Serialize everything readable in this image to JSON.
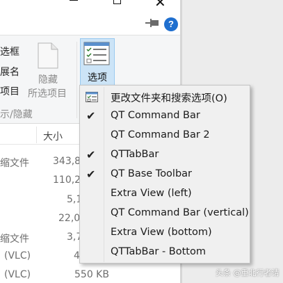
{
  "ribbon": {
    "left_labels": [
      "选框",
      "展名",
      "项目",
      "示/隐藏"
    ],
    "hide_button": {
      "line1": "隐藏",
      "line2": "所选项目"
    },
    "options_button": "选项"
  },
  "file_list": {
    "size_header": "大小",
    "rows": [
      {
        "name": "缩文件",
        "size": "343,8"
      },
      {
        "name": "",
        "size": "110,2"
      },
      {
        "name": "",
        "size": "5,1"
      },
      {
        "name": "",
        "size": "22,0"
      },
      {
        "name": "缩文件",
        "size": "3,7"
      },
      {
        "name": "(VLC)",
        "size": "4"
      },
      {
        "name": "(VLC)",
        "size": "550 KB"
      }
    ]
  },
  "menu": {
    "items": [
      {
        "label": "更改文件夹和搜索选项(O)",
        "checked": false,
        "icon": "folder-options-icon"
      },
      {
        "label": "QT Command Bar",
        "checked": true
      },
      {
        "label": "QT Command Bar 2",
        "checked": false
      },
      {
        "label": "QTTabBar",
        "checked": true
      },
      {
        "label": "QT Base Toolbar",
        "checked": true
      },
      {
        "label": "Extra View (left)",
        "checked": false
      },
      {
        "label": "QT Command Bar (vertical)",
        "checked": false
      },
      {
        "label": "Extra View (bottom)",
        "checked": false
      },
      {
        "label": "QTTabBar - Bottom",
        "checked": false
      }
    ]
  },
  "watermark": "头条 @重北行者请",
  "colors": {
    "help_blue": "#1f6fcf",
    "options_highlight": "#cce4f7",
    "menu_bg": "#f0f0f0"
  }
}
